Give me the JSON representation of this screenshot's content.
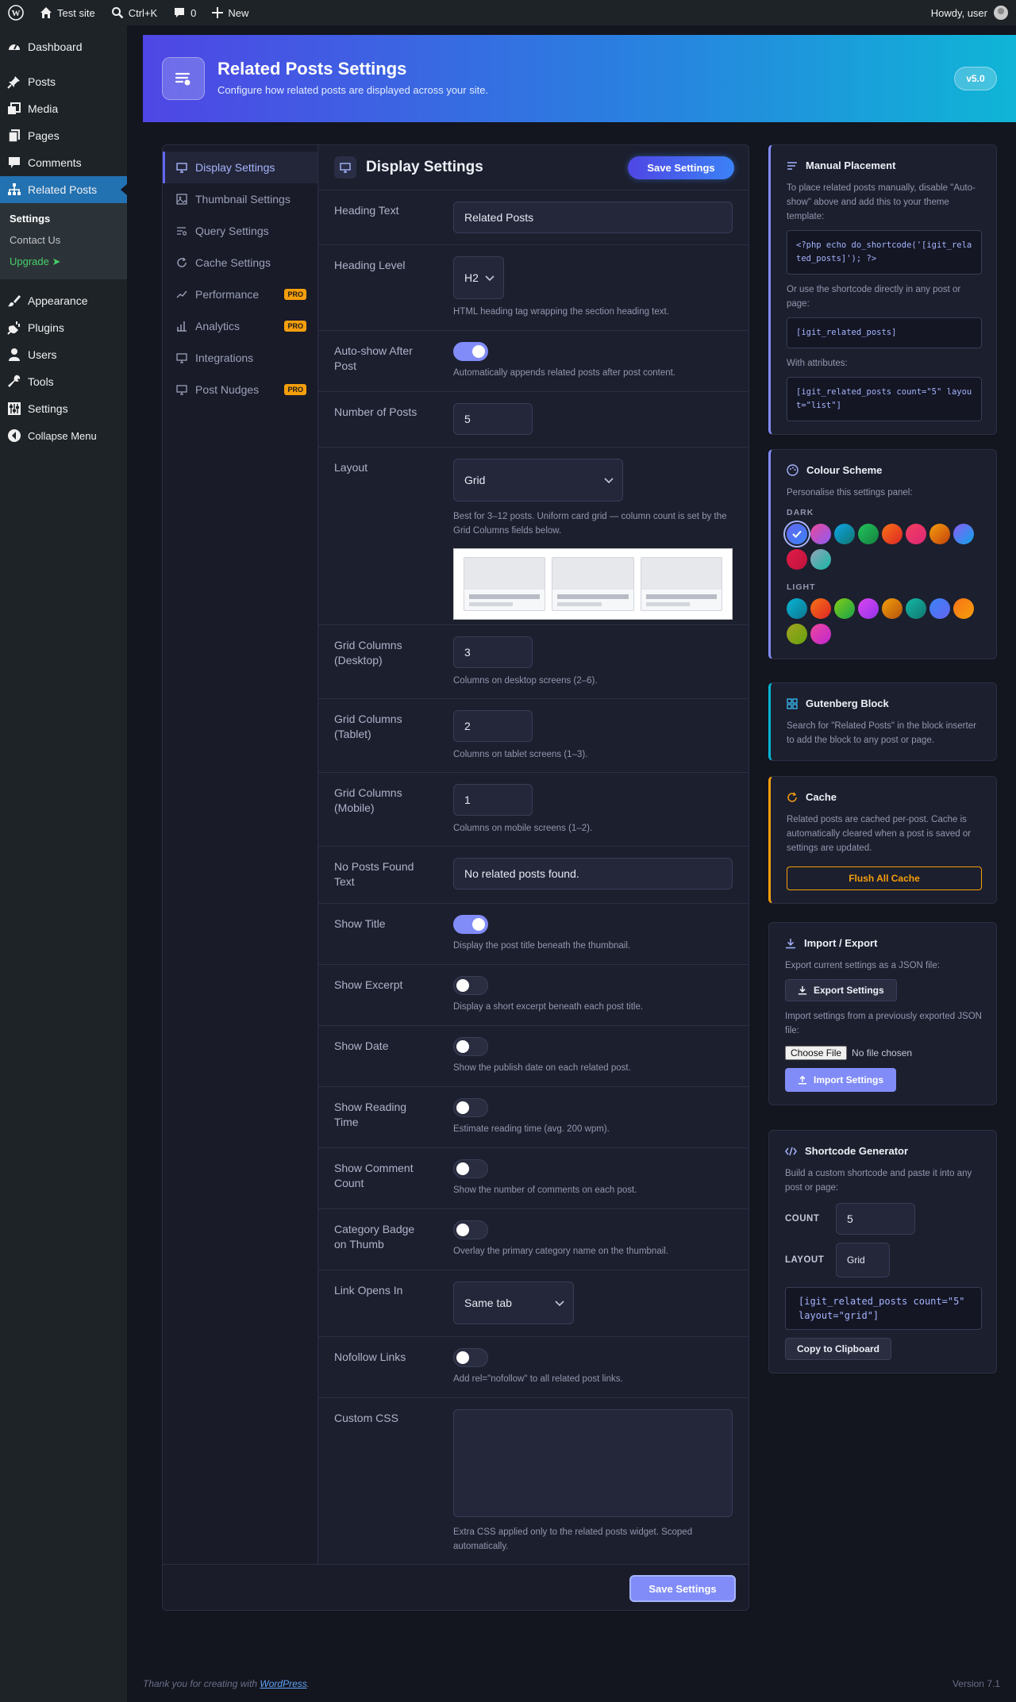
{
  "admin_bar": {
    "site": "Test site",
    "search": "Ctrl+K",
    "comments": "0",
    "new": "New",
    "howdy": "Howdy, user"
  },
  "sidebar": {
    "items": [
      {
        "label": "Dashboard",
        "icon": "dashboard-icon"
      },
      {
        "label": "Posts",
        "icon": "pin-icon"
      },
      {
        "label": "Media",
        "icon": "media-icon"
      },
      {
        "label": "Pages",
        "icon": "pages-icon"
      },
      {
        "label": "Comments",
        "icon": "comment-icon"
      },
      {
        "label": "Related Posts",
        "icon": "sitemap-icon"
      }
    ],
    "submenu": [
      "Settings",
      "Contact Us",
      "Upgrade ➤"
    ],
    "items2": [
      {
        "label": "Appearance",
        "icon": "brush-icon"
      },
      {
        "label": "Plugins",
        "icon": "plug-icon"
      },
      {
        "label": "Users",
        "icon": "user-icon"
      },
      {
        "label": "Tools",
        "icon": "wrench-icon"
      },
      {
        "label": "Settings",
        "icon": "sliders-icon"
      },
      {
        "label": "Collapse Menu",
        "icon": "collapse-icon"
      }
    ]
  },
  "hero": {
    "title": "Related Posts Settings",
    "subtitle": "Configure how related posts are displayed across your site.",
    "version": "v5.0"
  },
  "nav": {
    "items": [
      {
        "label": "Display Settings",
        "pro": ""
      },
      {
        "label": "Thumbnail Settings",
        "pro": ""
      },
      {
        "label": "Query Settings",
        "pro": ""
      },
      {
        "label": "Cache Settings",
        "pro": ""
      },
      {
        "label": "Performance",
        "pro": "PRO"
      },
      {
        "label": "Analytics",
        "pro": "PRO"
      },
      {
        "label": "Integrations",
        "pro": ""
      },
      {
        "label": "Post Nudges",
        "pro": "PRO"
      }
    ]
  },
  "form": {
    "title": "Display Settings",
    "save_label": "Save Settings",
    "heading_text": {
      "label": "Heading Text",
      "value": "Related Posts"
    },
    "heading_level": {
      "label": "Heading Level",
      "value": "H2",
      "help": "HTML heading tag wrapping the section heading text."
    },
    "auto_show": {
      "label": "Auto-show After Post",
      "on": true,
      "help": "Automatically appends related posts after post content."
    },
    "num_posts": {
      "label": "Number of Posts",
      "value": "5"
    },
    "layout": {
      "label": "Layout",
      "value": "Grid",
      "help": "Best for 3–12 posts. Uniform card grid — column count is set by the Grid Columns fields below."
    },
    "grid_desktop": {
      "label": "Grid Columns (Desktop)",
      "value": "3",
      "help": "Columns on desktop screens (2–6)."
    },
    "grid_tablet": {
      "label": "Grid Columns (Tablet)",
      "value": "2",
      "help": "Columns on tablet screens (1–3)."
    },
    "grid_mobile": {
      "label": "Grid Columns (Mobile)",
      "value": "1",
      "help": "Columns on mobile screens (1–2)."
    },
    "no_posts": {
      "label": "No Posts Found Text",
      "value": "No related posts found."
    },
    "show_title": {
      "label": "Show Title",
      "on": true,
      "help": "Display the post title beneath the thumbnail."
    },
    "show_excerpt": {
      "label": "Show Excerpt",
      "on": false,
      "help": "Display a short excerpt beneath each post title."
    },
    "show_date": {
      "label": "Show Date",
      "on": false,
      "help": "Show the publish date on each related post."
    },
    "show_reading": {
      "label": "Show Reading Time",
      "on": false,
      "help": "Estimate reading time (avg. 200 wpm)."
    },
    "show_comments": {
      "label": "Show Comment Count",
      "on": false,
      "help": "Show the number of comments on each post."
    },
    "cat_badge": {
      "label": "Category Badge on Thumb",
      "on": false,
      "help": "Overlay the primary category name on the thumbnail."
    },
    "link_opens": {
      "label": "Link Opens In",
      "value": "Same tab"
    },
    "nofollow": {
      "label": "Nofollow Links",
      "on": false,
      "help": "Add rel=\"nofollow\" to all related post links."
    },
    "custom_css": {
      "label": "Custom CSS",
      "help": "Extra CSS applied only to the related posts widget. Scoped automatically."
    },
    "footer_save": "Save Settings"
  },
  "manual": {
    "title": "Manual Placement",
    "p1": "To place related posts manually, disable \"Auto-show\" above and add this to your theme template:",
    "code1": "<?php echo do_shortcode('[igit_related_posts]'); ?>",
    "p2": "Or use the shortcode directly in any post or page:",
    "code2": "[igit_related_posts]",
    "p3": "With attributes:",
    "code3": "[igit_related_posts count=\"5\" layout=\"list\"]"
  },
  "colour": {
    "title": "Colour Scheme",
    "desc": "Personalise this settings panel:",
    "dark_label": "DARK",
    "light_label": "LIGHT",
    "dark": [
      [
        "#6366f1",
        "#3b82f6"
      ],
      [
        "#ec4899",
        "#8b5cf6"
      ],
      [
        "#0ea5e9",
        "#0f766e"
      ],
      [
        "#22c55e",
        "#15803d"
      ],
      [
        "#f97316",
        "#dc2626"
      ],
      [
        "#f43f5e",
        "#db2777"
      ],
      [
        "#f59e0b",
        "#c2410c"
      ],
      [
        "#8b5cf6",
        "#0ea5e9"
      ],
      [
        "#e11d48",
        "#be123c"
      ],
      [
        "#94a3b8",
        "#14b8a6"
      ]
    ],
    "light": [
      [
        "#06b6d4",
        "#0e7490"
      ],
      [
        "#f97316",
        "#dc2626"
      ],
      [
        "#84cc16",
        "#16a34a"
      ],
      [
        "#d946ef",
        "#9333ea"
      ],
      [
        "#f59e0b",
        "#b45309"
      ],
      [
        "#14b8a6",
        "#0f766e"
      ],
      [
        "#3b82f6",
        "#6366f1"
      ],
      [
        "#f97316",
        "#f59e0b"
      ],
      [
        "#a3a322",
        "#65a30d"
      ],
      [
        "#ec4899",
        "#c026d3"
      ]
    ]
  },
  "gutenberg": {
    "title": "Gutenberg Block",
    "desc": "Search for \"Related Posts\" in the block inserter to add the block to any post or page."
  },
  "cache": {
    "title": "Cache",
    "desc": "Related posts are cached per-post. Cache is automatically cleared when a post is saved or settings are updated.",
    "button": "Flush All Cache"
  },
  "import_export": {
    "title": "Import / Export",
    "p1": "Export current settings as a JSON file:",
    "export_btn": "Export Settings",
    "p2": "Import settings from a previously exported JSON file:",
    "file_btn": "Choose File",
    "file_status": "No file chosen",
    "import_btn": "Import Settings"
  },
  "shortcode_gen": {
    "title": "Shortcode Generator",
    "desc": "Build a custom shortcode and paste it into any post or page:",
    "count_label": "COUNT",
    "count_value": "5",
    "layout_label": "LAYOUT",
    "layout_value": "Grid",
    "output": "[igit_related_posts count=\"5\" layout=\"grid\"]",
    "copy_btn": "Copy to Clipboard"
  },
  "footer": {
    "thanks": "Thank you for creating with ",
    "link": "WordPress",
    "dot": ".",
    "version": "Version 7.1"
  },
  "colors": {
    "accent": "#6366f1",
    "pro_badge": "#f59e0b",
    "hero_start": "#4f46e5",
    "hero_end": "#0fb5d6"
  }
}
